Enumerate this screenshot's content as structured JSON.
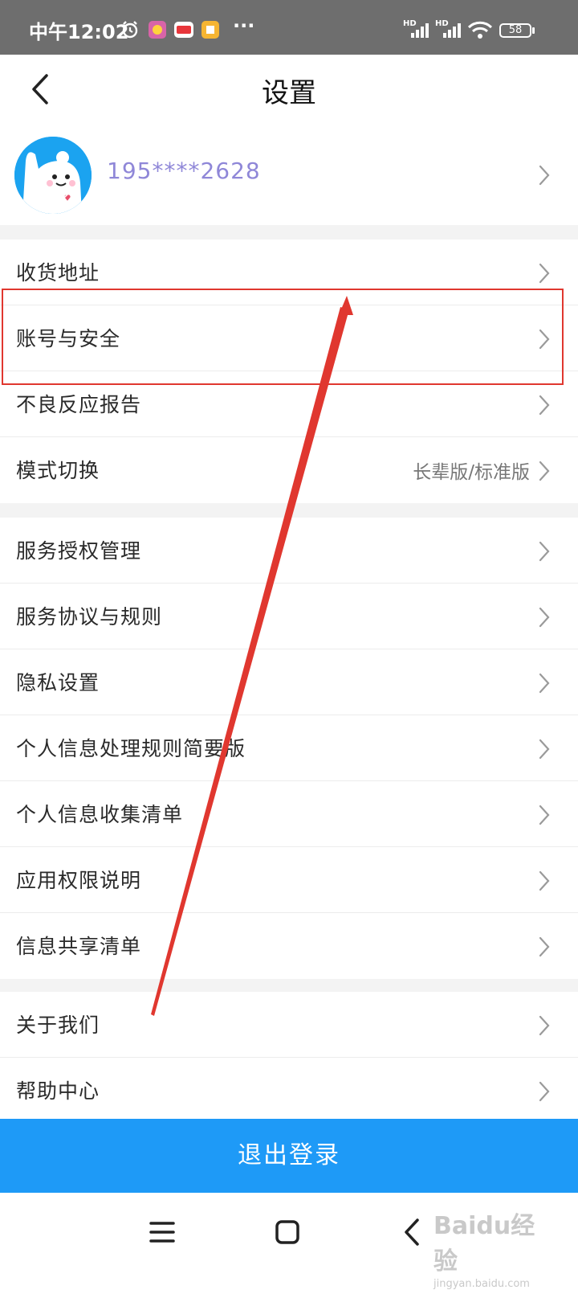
{
  "status_bar": {
    "time": "中午12:02",
    "more": "···",
    "battery": "58",
    "signal_label_1": "HD",
    "signal_label_2": "HD"
  },
  "header": {
    "title": "设置"
  },
  "profile": {
    "phone": "195****2628"
  },
  "groups": [
    {
      "items": [
        {
          "label": "收货地址"
        },
        {
          "label": "账号与安全"
        },
        {
          "label": "不良反应报告"
        },
        {
          "label": "模式切换",
          "value": "长辈版/标准版"
        }
      ]
    },
    {
      "items": [
        {
          "label": "服务授权管理"
        },
        {
          "label": "服务协议与规则"
        },
        {
          "label": "隐私设置"
        },
        {
          "label": "个人信息处理规则简要版"
        },
        {
          "label": "个人信息收集清单"
        },
        {
          "label": "应用权限说明"
        },
        {
          "label": "信息共享清单"
        }
      ]
    },
    {
      "items": [
        {
          "label": "关于我们"
        },
        {
          "label": "帮助中心"
        }
      ]
    }
  ],
  "logout_label": "退出登录",
  "watermark": {
    "text": "Baidu经验",
    "sub": "jingyan.baidu.com"
  },
  "colors": {
    "accent": "#1e9af7",
    "highlight": "#e0372f",
    "phone": "#8f87d8"
  }
}
